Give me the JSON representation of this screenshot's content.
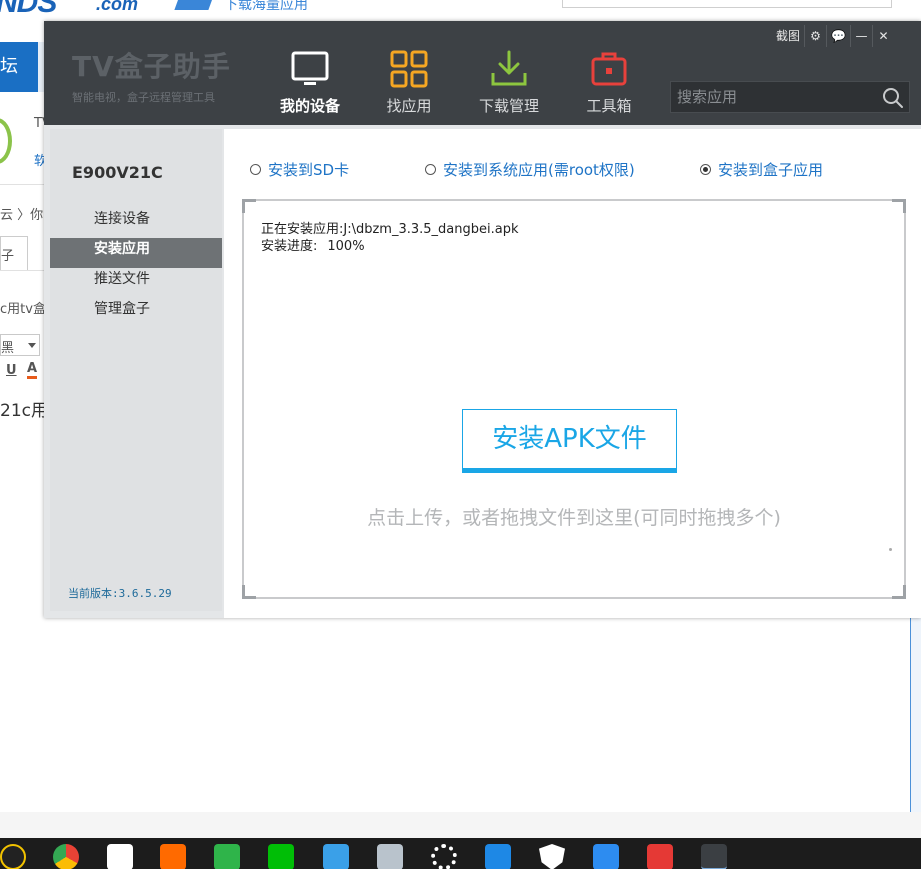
{
  "browser_background": {
    "logo_text": "NDS",
    "logo_com": ".com",
    "logo_tagline": "下载海量应用",
    "nav_label": "坛",
    "snippet_1": "TV",
    "snippet_2": "软",
    "breadcrumb": "云 〉你",
    "tab_label": "子",
    "title_snippet": "c用tv盒",
    "select_value": "黑",
    "toolbar_u": "U",
    "toolbar_a": "A",
    "body_snippet": "21c用"
  },
  "app": {
    "brand_title": "TV盒子助手",
    "brand_subtitle": "智能电视，盒子远程管理工具",
    "window_controls": {
      "screenshot": "截图",
      "settings": "⚙",
      "feedback": "💬",
      "minimize": "—",
      "close": "✕"
    },
    "nav": [
      {
        "label": "我的设备",
        "icon": "tv-device-icon",
        "active": true
      },
      {
        "label": "找应用",
        "icon": "app-grid-icon",
        "active": false
      },
      {
        "label": "下载管理",
        "icon": "download-icon",
        "active": false
      },
      {
        "label": "工具箱",
        "icon": "toolbox-icon",
        "active": false
      }
    ],
    "search": {
      "placeholder": "搜索应用"
    },
    "sidebar": {
      "device_name": "E900V21C",
      "items": [
        {
          "label": "连接设备",
          "active": false
        },
        {
          "label": "安装应用",
          "active": true
        },
        {
          "label": "推送文件",
          "active": false
        },
        {
          "label": "管理盒子",
          "active": false
        }
      ],
      "version": "当前版本:3.6.5.29"
    },
    "main": {
      "install_options": [
        {
          "label": "安装到SD卡",
          "checked": false
        },
        {
          "label": "安装到系统应用(需root权限)",
          "checked": false
        },
        {
          "label": "安装到盒子应用",
          "checked": true
        }
      ],
      "status_installing": "正在安装应用:J:\\dbzm_3.3.5_dangbei.apk",
      "status_progress_label": "安装进度:",
      "status_progress_value": "100%",
      "install_button": "安装APK文件",
      "drop_hint": "点击上传，或者拖拽文件到这里(可同时拖拽多个)"
    }
  },
  "taskbar": {
    "icons": [
      "qq-icon",
      "chrome-icon",
      "media-icon",
      "mango-tv-icon",
      "video-player-icon",
      "iqiyi-icon",
      "remote-desktop-icon",
      "photos-icon",
      "settings-icon",
      "phone-icon",
      "security-shield-icon",
      "search-q-icon",
      "tools-icon",
      "tv-assistant-icon"
    ]
  },
  "colors": {
    "header_bg": "#3d4145",
    "accent_blue": "#1aa6e6",
    "link_blue": "#1f74c6",
    "sidebar_active": "#6e7275"
  }
}
